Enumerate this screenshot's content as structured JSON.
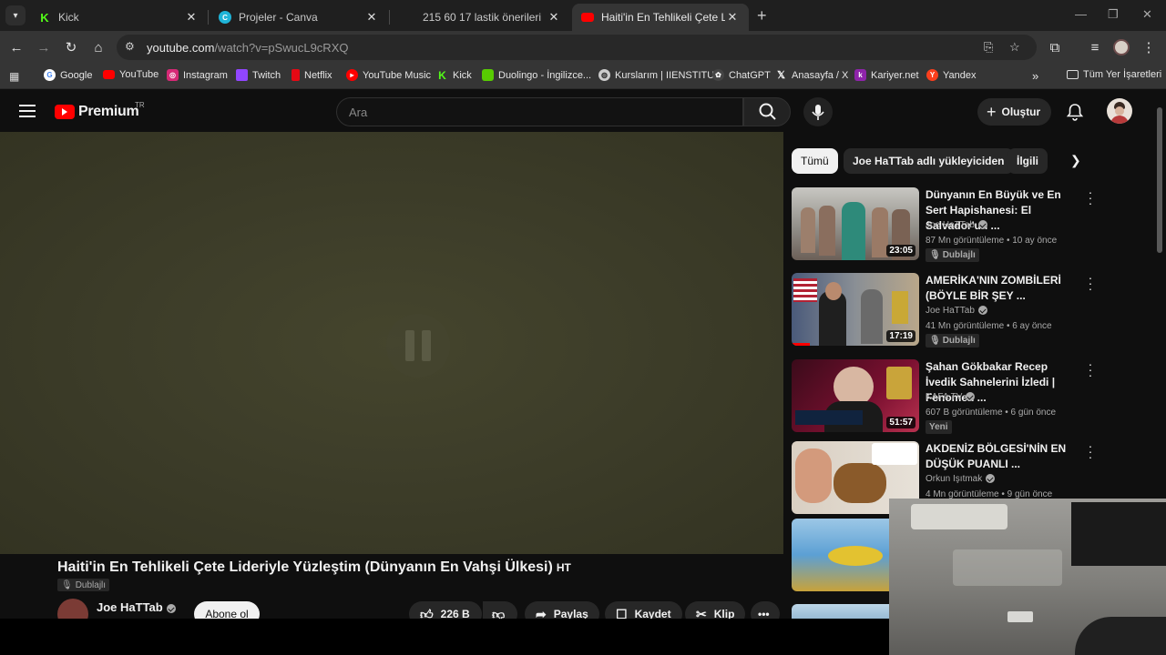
{
  "tabs": [
    {
      "title": "Kick",
      "active": false
    },
    {
      "title": "Projeler - Canva",
      "active": false
    },
    {
      "title": "215 60 17 lastik önerileri",
      "active": false
    },
    {
      "title": "Haiti'in En Tehlikeli Çete Lideriyle Yüzleştim",
      "active": true
    }
  ],
  "toolbar": {
    "url_host": "youtube.com",
    "url_path": "/watch?v=pSwucL9cRXQ"
  },
  "bookmarks": [
    {
      "label": "Google",
      "color": "#ffffff"
    },
    {
      "label": "YouTube",
      "color": "#ff0000"
    },
    {
      "label": "Instagram",
      "color": "#d62976"
    },
    {
      "label": "Twitch",
      "color": "#9146ff"
    },
    {
      "label": "Netflix",
      "color": "#e50914"
    },
    {
      "label": "YouTube Music",
      "color": "#ff0000"
    },
    {
      "label": "Kick",
      "color": "#53fc18"
    },
    {
      "label": "Duolingo - İngilizce...",
      "color": "#58cc02"
    },
    {
      "label": "Kurslarım | IIENSTITU",
      "color": "#cccccc"
    },
    {
      "label": "ChatGPT",
      "color": "#444444"
    },
    {
      "label": "Anasayfa / X",
      "color": "#000000"
    },
    {
      "label": "Kariyer.net",
      "color": "#8e24aa"
    },
    {
      "label": "Yandex",
      "color": "#fc3f1d"
    }
  ],
  "bookmarks_all": "Tüm Yer İşaretleri",
  "yt": {
    "logo": "Premium",
    "country": "TR",
    "search_placeholder": "Ara",
    "create_label": "Oluştur"
  },
  "video": {
    "title": "Haiti'in En Tehlikeli Çete Lideriyle Yüzleştim (Dünyanın En Vahşi Ülkesi)",
    "title_suffix": "HT",
    "dub_label": "Dublajlı",
    "channel": "Joe HaTTab",
    "subscribe": "Abone ol",
    "likes": "226 B",
    "share": "Paylaş",
    "save": "Kaydet",
    "clip": "Klip"
  },
  "chips": [
    "Tümü",
    "Joe HaTTab adlı yükleyiciden",
    "İlgili"
  ],
  "recommendations": [
    {
      "title": "Dünyanın En Büyük ve En Sert Hapishanesi: El Salvador'un ...",
      "channel": "Joe HaTTab",
      "meta": "87 Mn görüntüleme • 10 ay önce",
      "duration": "23:05",
      "badge": "Dublajlı",
      "progress": 0.0
    },
    {
      "title": "AMERİKA'NIN ZOMBİLERİ (BÖYLE BİR ŞEY ...",
      "channel": "Joe HaTTab",
      "meta": "41 Mn görüntüleme • 6 ay önce",
      "duration": "17:19",
      "badge": "Dublajlı",
      "progress": 0.14
    },
    {
      "title": "Şahan Gökbakar Recep İvedik Sahnelerini İzledi | Fenomen ...",
      "channel": "KAFA TV",
      "meta": "607 B görüntüleme • 6 gün önce",
      "duration": "51:57",
      "badge": "Yeni",
      "progress": 0.0
    },
    {
      "title": "AKDENİZ BÖLGESİ'NİN EN DÜŞÜK PUANLI ...",
      "channel": "Orkun Işıtmak",
      "meta": "4 Mn görüntüleme • 9 gün önce",
      "duration": "",
      "badge": "",
      "progress": 0.0
    }
  ]
}
